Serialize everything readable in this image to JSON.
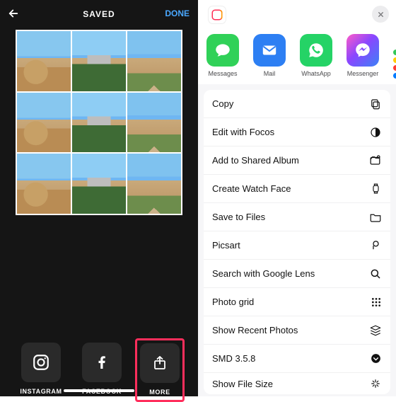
{
  "left": {
    "title": "SAVED",
    "done": "DONE",
    "share": {
      "instagram": "INSTAGRAM",
      "facebook": "FACEBOOK",
      "more": "MORE"
    }
  },
  "right": {
    "apps": {
      "messages": "Messages",
      "mail": "Mail",
      "whatsapp": "WhatsApp",
      "messenger": "Messenger"
    },
    "actions": {
      "copy": "Copy",
      "focos": "Edit with Focos",
      "shared_album": "Add to Shared Album",
      "watch_face": "Create Watch Face",
      "save_files": "Save to Files",
      "picsart": "Picsart",
      "lens": "Search with Google Lens",
      "photo_grid": "Photo grid",
      "recent": "Show Recent Photos",
      "smd": "SMD 3.5.8",
      "file_size": "Show File Size"
    }
  }
}
